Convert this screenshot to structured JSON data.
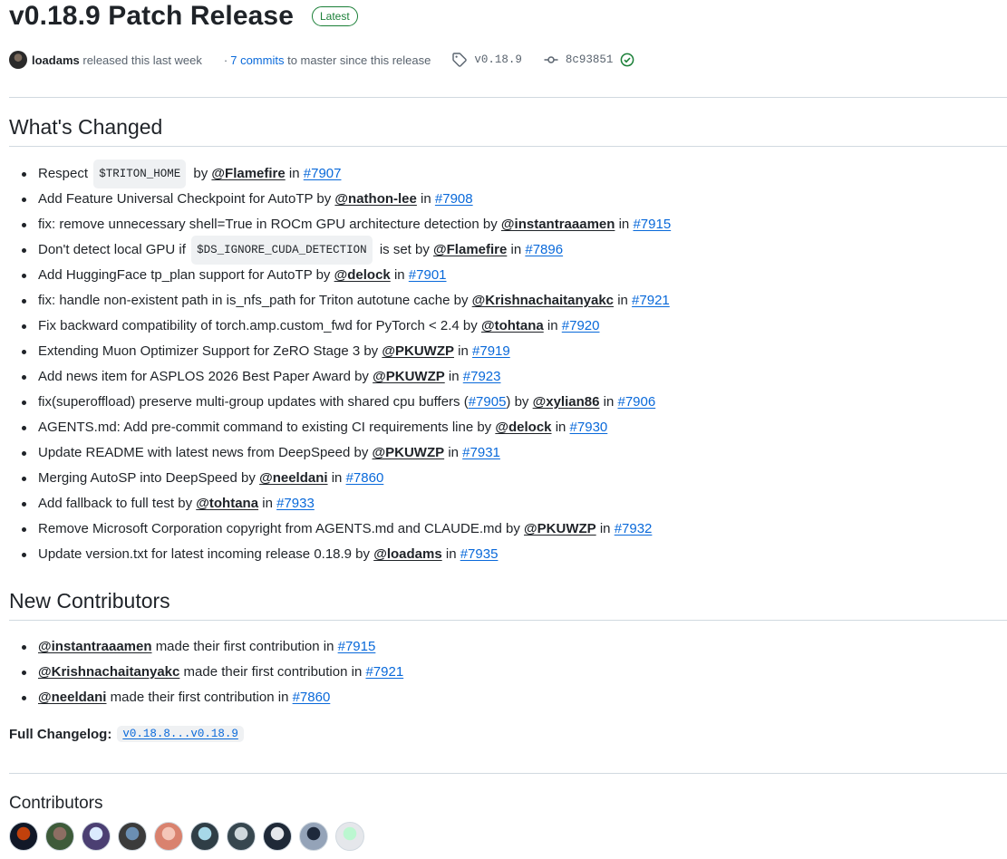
{
  "release": {
    "title": "v0.18.9 Patch Release",
    "badge": "Latest"
  },
  "meta": {
    "author": "loadams",
    "released_text": "released this last week",
    "dot": "·",
    "commits_link": "7 commits",
    "commits_suffix": "to master since this release",
    "tag": "v0.18.9",
    "commit_sha": "8c93851",
    "icons": {
      "tag": "tag-icon",
      "commit": "git-commit-icon",
      "verified": "check-circle-icon"
    }
  },
  "whats_changed": {
    "heading": "What's Changed",
    "items": [
      {
        "pre": "Respect",
        "code": "$TRITON_HOME",
        "mid": "by",
        "user": "@Flamefire",
        "in": "in",
        "pr": "#7907"
      },
      {
        "pre": "Add Feature Universal Checkpoint for AutoTP by",
        "user": "@nathon-lee",
        "in": "in",
        "pr": "#7908"
      },
      {
        "pre": "fix: remove unnecessary shell=True in ROCm GPU architecture detection by",
        "user": "@instantraaamen",
        "in": "in",
        "pr": "#7915"
      },
      {
        "pre": "Don't detect local GPU if",
        "code": "$DS_IGNORE_CUDA_DETECTION",
        "mid": "is set by",
        "user": "@Flamefire",
        "in": "in",
        "pr": "#7896"
      },
      {
        "pre": "Add HuggingFace tp_plan support for AutoTP by",
        "user": "@delock",
        "in": "in",
        "pr": "#7901"
      },
      {
        "pre": "fix: handle non-existent path in is_nfs_path for Triton autotune cache by",
        "user": "@Krishnachaitanyakc",
        "in": "in",
        "pr": "#7921"
      },
      {
        "pre": "Fix backward compatibility of torch.amp.custom_fwd for PyTorch < 2.4 by",
        "user": "@tohtana",
        "in": "in",
        "pr": "#7920"
      },
      {
        "pre": "Extending Muon Optimizer Support for ZeRO Stage 3 by",
        "user": "@PKUWZP",
        "in": "in",
        "pr": "#7919"
      },
      {
        "pre": "Add news item for ASPLOS 2026 Best Paper Award by",
        "user": "@PKUWZP",
        "in": "in",
        "pr": "#7923"
      },
      {
        "pre": "fix(superoffload) preserve multi-group updates with shared cpu buffers (",
        "pr_inline": "#7905",
        "pre2": ") by",
        "user": "@xylian86",
        "in": "in",
        "pr": "#7906"
      },
      {
        "pre": "AGENTS.md: Add pre-commit command to existing CI requirements line by",
        "user": "@delock",
        "in": "in",
        "pr": "#7930"
      },
      {
        "pre": "Update README with latest news from DeepSpeed by",
        "user": "@PKUWZP",
        "in": "in",
        "pr": "#7931"
      },
      {
        "pre": "Merging AutoSP into DeepSpeed by",
        "user": "@neeldani",
        "in": "in",
        "pr": "#7860"
      },
      {
        "pre": "Add fallback to full test by",
        "user": "@tohtana",
        "in": "in",
        "pr": "#7933"
      },
      {
        "pre": "Remove Microsoft Corporation copyright from AGENTS.md and CLAUDE.md by",
        "user": "@PKUWZP",
        "in": "in",
        "pr": "#7932"
      },
      {
        "pre": "Update version.txt for latest incoming release 0.18.9 by",
        "user": "@loadams",
        "in": "in",
        "pr": "#7935"
      }
    ]
  },
  "new_contributors": {
    "heading": "New Contributors",
    "items": [
      {
        "user": "@instantraaamen",
        "text": "made their first contribution in",
        "pr": "#7915"
      },
      {
        "user": "@Krishnachaitanyakc",
        "text": "made their first contribution in",
        "pr": "#7921"
      },
      {
        "user": "@neeldani",
        "text": "made their first contribution in",
        "pr": "#7860"
      }
    ]
  },
  "changelog": {
    "label": "Full Changelog",
    "colon": ":",
    "range": "v0.18.8...v0.18.9"
  },
  "contributors": {
    "heading": "Contributors",
    "avatars": [
      {
        "colors": [
          "#c2410c",
          "#111827"
        ]
      },
      {
        "colors": [
          "#8d6e63",
          "#3e5b3a"
        ]
      },
      {
        "colors": [
          "#dbeafe",
          "#4b3f72"
        ]
      },
      {
        "colors": [
          "#6b8fb3",
          "#3b3b3b"
        ]
      },
      {
        "colors": [
          "#f4c6b8",
          "#d9826e"
        ]
      },
      {
        "colors": [
          "#a7d8e8",
          "#2f3e46"
        ]
      },
      {
        "colors": [
          "#cfd8dc",
          "#37474f"
        ]
      },
      {
        "colors": [
          "#e5e7eb",
          "#1f2937"
        ]
      },
      {
        "colors": [
          "#1e293b",
          "#94a3b8"
        ]
      },
      {
        "colors": [
          "#bbf7d0",
          "#e5e7eb"
        ]
      }
    ]
  },
  "colors": {
    "link": "#0969da",
    "success": "#1a7f37",
    "text": "#1f2328",
    "muted": "#59636e",
    "border": "#d1d9e0"
  }
}
